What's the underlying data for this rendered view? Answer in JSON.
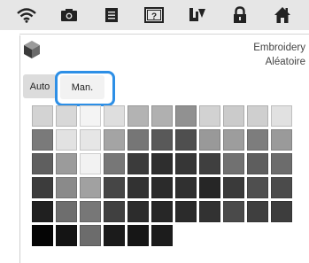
{
  "topbar": {
    "icons": [
      "wifi-icon",
      "camera-icon",
      "document-icon",
      "help-icon",
      "thread-spool-icon",
      "lock-icon",
      "home-icon"
    ]
  },
  "header": {
    "icon": "stitch-cube-icon",
    "title_line1": "Embroidery",
    "title_line2": "Aléatoire"
  },
  "mode_buttons": {
    "auto_label": "Auto",
    "manual_label": "Man.",
    "selected": "Man."
  },
  "colors": {
    "accent": "#2d8fe6",
    "topbar": "#e6e6e6"
  },
  "palette": {
    "columns": 11,
    "rows": [
      [
        "#d3d3d3",
        "#d8d8d8",
        "#f4f4f4",
        "#dedede",
        "#b3b3b3",
        "#b0b0b0",
        "#919191",
        "#d2d2d2",
        "#cbcbcb",
        "#cfcfcf",
        "#e1e1e1"
      ],
      [
        "#7a7a7a",
        "#e2e2e2",
        "#e6e6e6",
        "#a4a4a4",
        "#767676",
        "#595959",
        "#4f4f4f",
        "#999999",
        "#9d9d9d",
        "#7d7d7d",
        "#9a9a9a"
      ],
      [
        "#5f5f5f",
        "#9b9b9b",
        "#f2f2f2",
        "#777777",
        "#3b3b3b",
        "#2e2e2e",
        "#363636",
        "#3f3f3f",
        "#717171",
        "#5e5e5e",
        "#6c6c6c"
      ],
      [
        "#3c3c3c",
        "#8a8a8a",
        "#a1a1a1",
        "#464646",
        "#323232",
        "#2b2b2b",
        "#303030",
        "#262626",
        "#3a3a3a",
        "#4f4f4f",
        "#4b4b4b"
      ],
      [
        "#202020",
        "#6e6e6e",
        "#777777",
        "#404040",
        "#2c2c2c",
        "#272727",
        "#2b2b2b",
        "#323232",
        "#4a4a4a",
        "#3f3f3f",
        "#3d3d3d"
      ],
      [
        "#050505",
        "#141414",
        "#6c6c6c",
        "#1b1b1b",
        "#161616",
        "#1c1c1c",
        null,
        null,
        null,
        null,
        null
      ]
    ]
  }
}
